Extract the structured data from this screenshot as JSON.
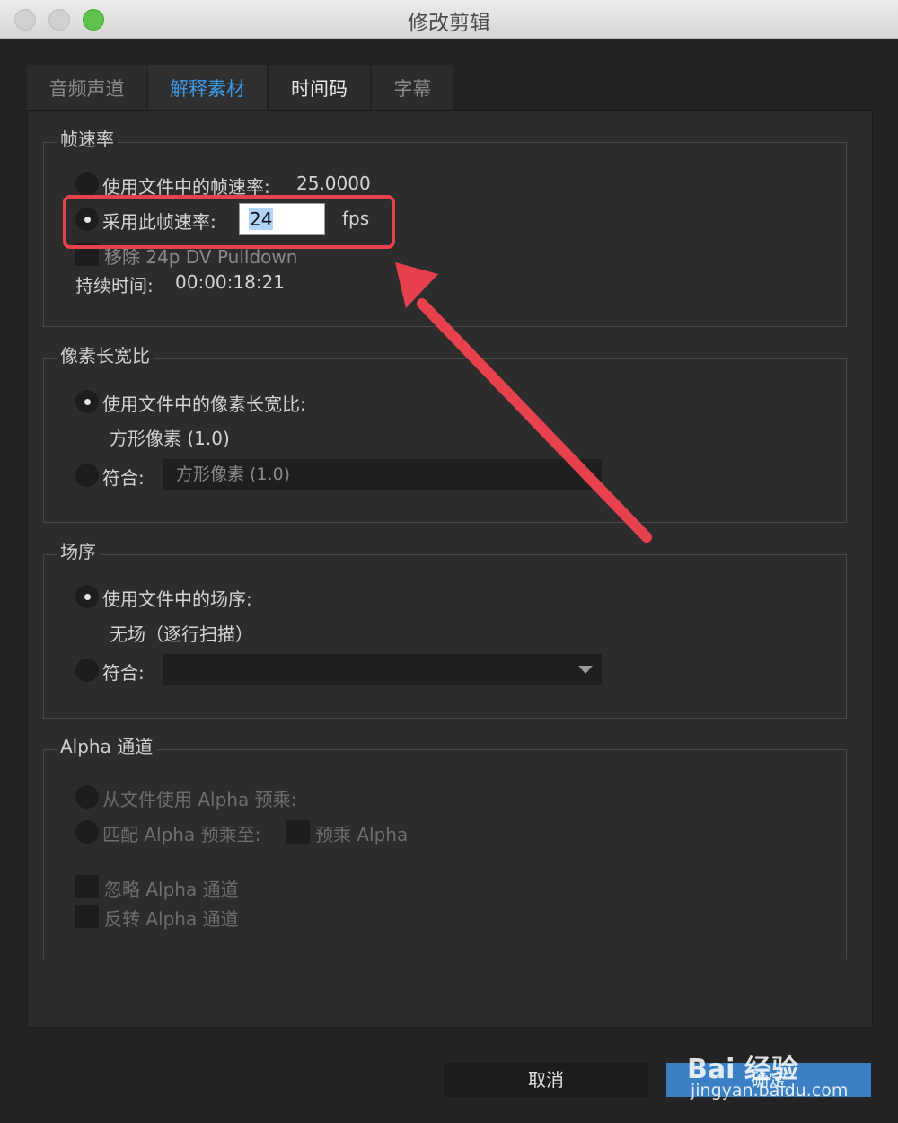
{
  "window": {
    "title": "修改剪辑"
  },
  "tabs": [
    {
      "label": "音频声道"
    },
    {
      "label": "解释素材"
    },
    {
      "label": "时间码"
    },
    {
      "label": "字幕"
    }
  ],
  "frame_rate": {
    "title": "帧速率",
    "use_file_label": "使用文件中的帧速率:",
    "use_file_value": "25.0000",
    "assume_label": "采用此帧速率:",
    "assume_value": "24",
    "unit": "fps",
    "remove_pulldown_label": "移除 24p DV Pulldown",
    "duration_label": "持续时间:",
    "duration_value": "00:00:18:21"
  },
  "pixel_aspect": {
    "title": "像素长宽比",
    "use_file_label": "使用文件中的像素长宽比:",
    "use_file_value": "方形像素 (1.0)",
    "conform_label": "符合:",
    "conform_value": "方形像素 (1.0)"
  },
  "field_order": {
    "title": "场序",
    "use_file_label": "使用文件中的场序:",
    "use_file_value": "无场（逐行扫描）",
    "conform_label": "符合:",
    "conform_value": ""
  },
  "alpha": {
    "title": "Alpha 通道",
    "from_file_label": "从文件使用 Alpha 预乘:",
    "match_label": "匹配 Alpha 预乘至:",
    "premultiply_label": "预乘 Alpha",
    "ignore_label": "忽略 Alpha 通道",
    "invert_label": "反转 Alpha 通道"
  },
  "buttons": {
    "cancel": "取消",
    "ok": "确定"
  },
  "watermark": {
    "main": "Bai 经验",
    "sub": "jingyan.baidu.com"
  },
  "colors": {
    "accent": "#3d9ae8",
    "highlight": "#e8414e",
    "background": "#232323"
  }
}
